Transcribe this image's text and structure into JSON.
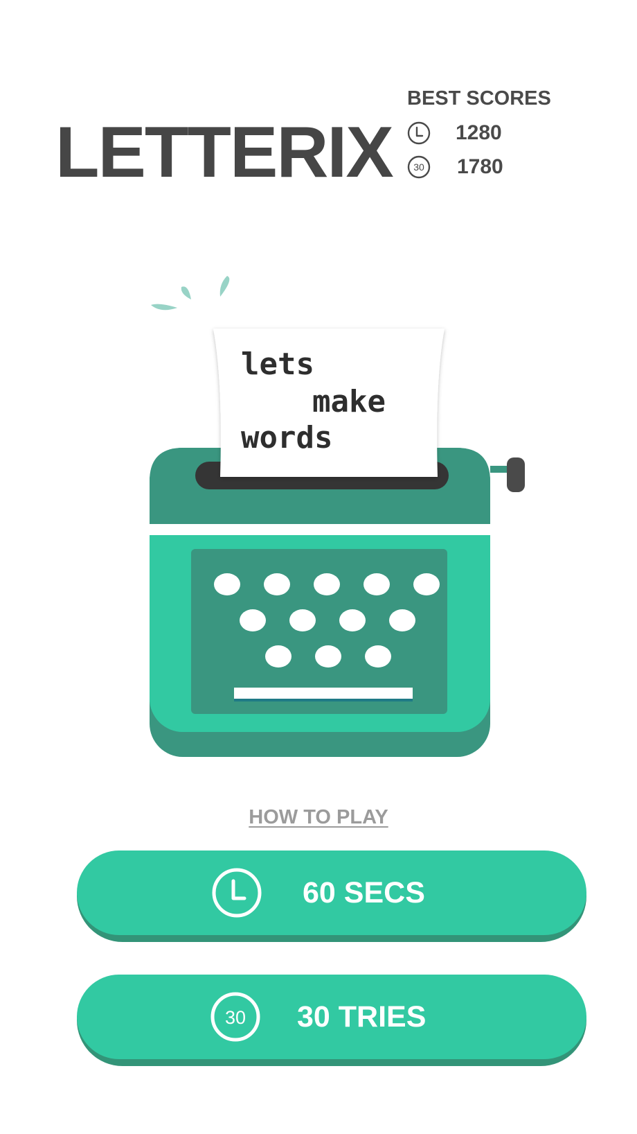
{
  "app": {
    "title": "LETTERIX"
  },
  "best_scores": {
    "heading": "BEST SCORES",
    "timed": {
      "icon": "clock-icon",
      "value": "1280"
    },
    "tries": {
      "icon": "thirty-badge-icon",
      "badge_text": "30",
      "value": "1780"
    }
  },
  "illustration": {
    "paper_lines": [
      "lets",
      "make",
      "words"
    ]
  },
  "links": {
    "how_to_play": "HOW TO PLAY"
  },
  "modes": {
    "timed": {
      "icon": "clock-icon",
      "label": "60 SECS"
    },
    "tries": {
      "icon": "thirty-badge-icon",
      "badge_text": "30",
      "label": "30 TRIES"
    }
  },
  "colors": {
    "text_dark": "#464646",
    "accent_green": "#32c9a2",
    "dark_green": "#3a9680",
    "link_gray": "#9b9b9b"
  }
}
